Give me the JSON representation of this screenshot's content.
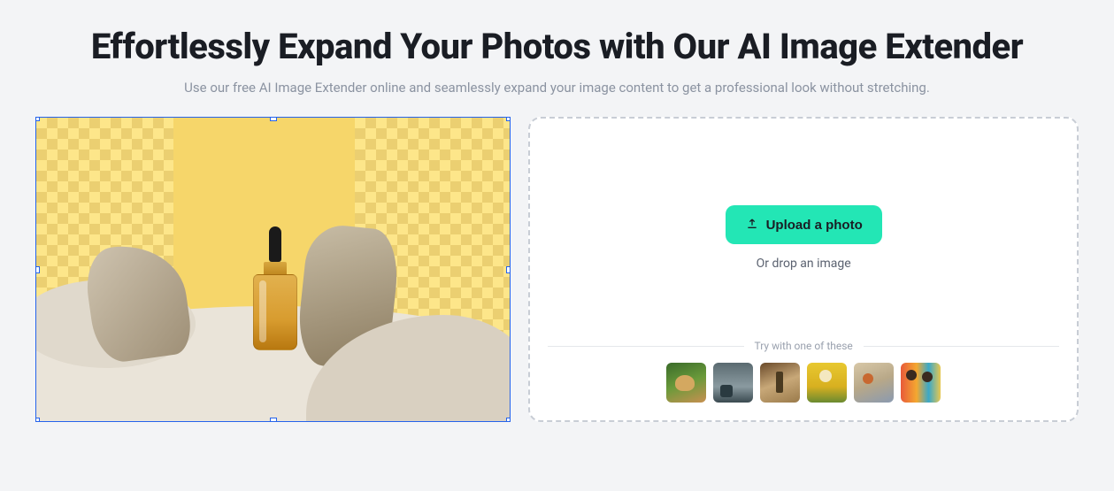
{
  "heading": "Effortlessly Expand Your Photos with Our AI Image Extender",
  "subheading": "Use our free AI Image Extender online and seamlessly expand your image content to get a professional look without stretching.",
  "upload": {
    "button_label": "Upload a photo",
    "drop_text": "Or drop an image"
  },
  "samples": {
    "label": "Try with one of these",
    "items": [
      {
        "name": "sample-dog"
      },
      {
        "name": "sample-chair"
      },
      {
        "name": "sample-bottle"
      },
      {
        "name": "sample-field"
      },
      {
        "name": "sample-beach"
      },
      {
        "name": "sample-art"
      }
    ]
  }
}
